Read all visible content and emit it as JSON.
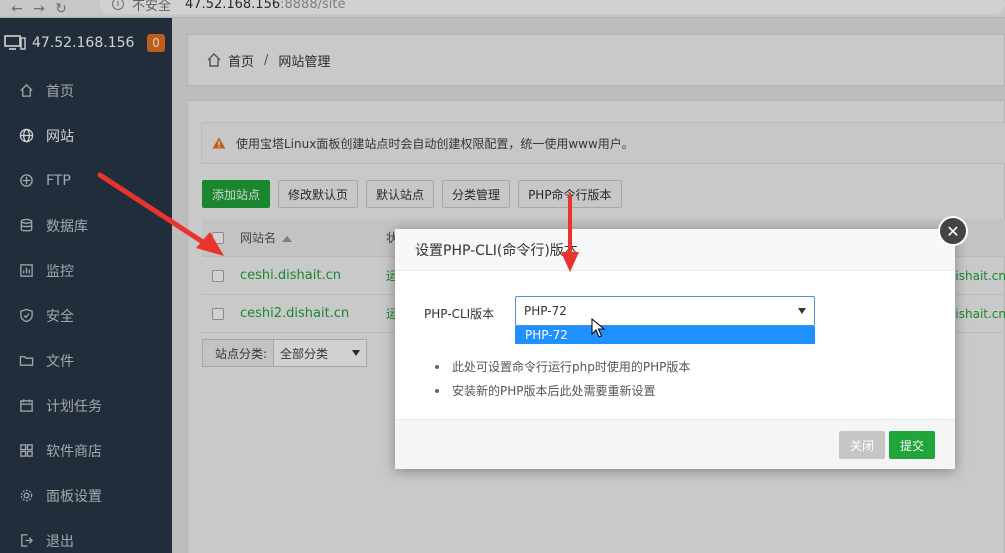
{
  "browser": {
    "security_label": "不安全",
    "url_host": "47.52.168.156",
    "url_rest": ":8888/site"
  },
  "sidebar": {
    "server_ip": "47.52.168.156",
    "badge": "0",
    "items": [
      {
        "label": "首页",
        "icon": "home-icon"
      },
      {
        "label": "网站",
        "icon": "globe-icon",
        "active": true
      },
      {
        "label": "FTP",
        "icon": "ftp-icon"
      },
      {
        "label": "数据库",
        "icon": "database-icon"
      },
      {
        "label": "监控",
        "icon": "monitor-chart-icon"
      },
      {
        "label": "安全",
        "icon": "shield-icon"
      },
      {
        "label": "文件",
        "icon": "folder-icon"
      },
      {
        "label": "计划任务",
        "icon": "calendar-icon"
      },
      {
        "label": "软件商店",
        "icon": "apps-grid-icon"
      },
      {
        "label": "面板设置",
        "icon": "gear-icon"
      },
      {
        "label": "退出",
        "icon": "logout-icon"
      }
    ]
  },
  "breadcrumb": {
    "home": "首页",
    "separator": "/",
    "current": "网站管理"
  },
  "notice": {
    "text": "使用宝塔Linux面板创建站点时会自动创建权限配置，统一使用www用户。"
  },
  "toolbar": {
    "add_site": "添加站点",
    "modify_default_page": "修改默认页",
    "default_site": "默认站点",
    "category_manage": "分类管理",
    "php_cli_version": "PHP命令行版本"
  },
  "table": {
    "col_site_name": "网站名",
    "col_status_partial": "状",
    "rows": [
      {
        "name": "ceshi.dishait.cn",
        "status_partial": "运",
        "domain_partial": "dishait.cn"
      },
      {
        "name": "ceshi2.dishait.cn",
        "status_partial": "运",
        "domain_partial": "dishait.cn"
      }
    ]
  },
  "filter": {
    "label": "站点分类:",
    "value": "全部分类"
  },
  "modal": {
    "title": "设置PHP-CLI(命令行)版本",
    "field_label": "PHP-CLI版本",
    "selected": "PHP-72",
    "option_highlighted": "PHP-72",
    "tips": [
      "此处可设置命令行运行php时使用的PHP版本",
      "安装新的PHP版本后此处需要重新设置"
    ],
    "close": "关闭",
    "submit": "提交"
  },
  "colors": {
    "sidebar_bg": "#293847",
    "accent_green": "#20a53a",
    "badge_orange": "#ea7520",
    "dropdown_highlight": "#1e90ff",
    "annotation_red": "#e8342c"
  }
}
